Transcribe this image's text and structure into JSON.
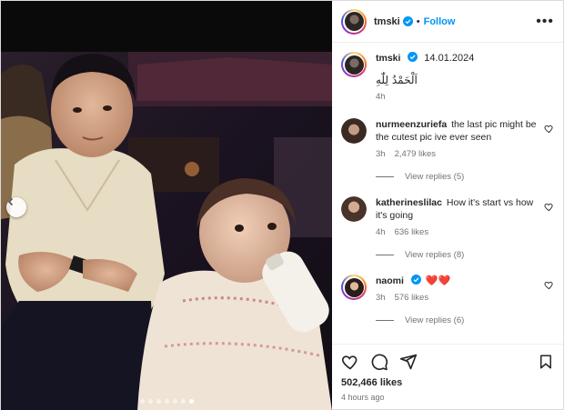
{
  "post": {
    "username": "tmski",
    "follow_label": "Follow",
    "more_label": "•••",
    "sep": "•"
  },
  "caption": {
    "username": "tmski",
    "date": "14.01.2024",
    "text": "اَلْحَمْدُ لِلّٰهِ",
    "age": "4h"
  },
  "comments": [
    {
      "username": "nurmeenzuriefa",
      "text": "the last pic might be the cutest pic ive ever seen",
      "age": "3h",
      "likes": "2,479 likes",
      "replies": "View replies (5)"
    },
    {
      "username": "katherineslilac",
      "text": "How it's start vs how it's going",
      "age": "4h",
      "likes": "636 likes",
      "replies": "View replies (8)"
    },
    {
      "username": "naomi",
      "text": "❤️❤️",
      "age": "3h",
      "likes": "576 likes",
      "replies": "View replies (6)"
    }
  ],
  "footer": {
    "likes": "502,466 likes",
    "ago": "4 hours ago"
  },
  "carousel": {
    "total": 7,
    "active": 6
  },
  "icons": [
    "heart-icon",
    "comment-icon",
    "share-icon",
    "bookmark-icon",
    "verified-icon",
    "chevron-left-icon"
  ],
  "colors": {
    "follow": "#0095f6",
    "verified": "#0095f6",
    "heart": "#ed1c24",
    "muted": "#737373"
  }
}
